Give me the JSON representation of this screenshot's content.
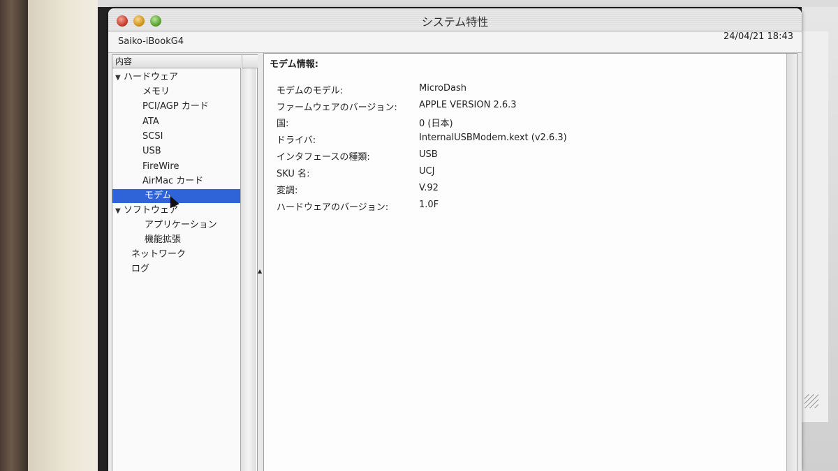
{
  "window": {
    "title": "システム特性",
    "computer_name": "Saiko-iBookG4",
    "datetime": "24/04/21 18:43"
  },
  "sidebar": {
    "header": "内容",
    "items": [
      {
        "label": "ハードウェア",
        "disclosure": "▼"
      },
      {
        "label": "メモリ"
      },
      {
        "label": "PCI/AGP カード"
      },
      {
        "label": "ATA"
      },
      {
        "label": "SCSI"
      },
      {
        "label": "USB"
      },
      {
        "label": "FireWire"
      },
      {
        "label": "AirMac カード"
      },
      {
        "label": "モデム",
        "selected": true
      },
      {
        "label": "ソフトウェア",
        "disclosure": "▼"
      },
      {
        "label": "アプリケーション"
      },
      {
        "label": "機能拡張"
      },
      {
        "label": "ネットワーク"
      },
      {
        "label": "ログ"
      }
    ]
  },
  "content": {
    "header": "モデム情報:",
    "rows": [
      {
        "key": "モデムのモデル:",
        "value": "MicroDash"
      },
      {
        "key": "ファームウェアのバージョン:",
        "value": "APPLE VERSION 2.6.3"
      },
      {
        "key": "国:",
        "value": "0 (日本)"
      },
      {
        "key": "ドライバ:",
        "value": "InternalUSBModem.kext (v2.6.3)"
      },
      {
        "key": "インタフェースの種類:",
        "value": "USB"
      },
      {
        "key": "SKU 名:",
        "value": "UCJ"
      },
      {
        "key": "変調:",
        "value": "V.92"
      },
      {
        "key": "ハードウェアのバージョン:",
        "value": "1.0F"
      }
    ]
  }
}
